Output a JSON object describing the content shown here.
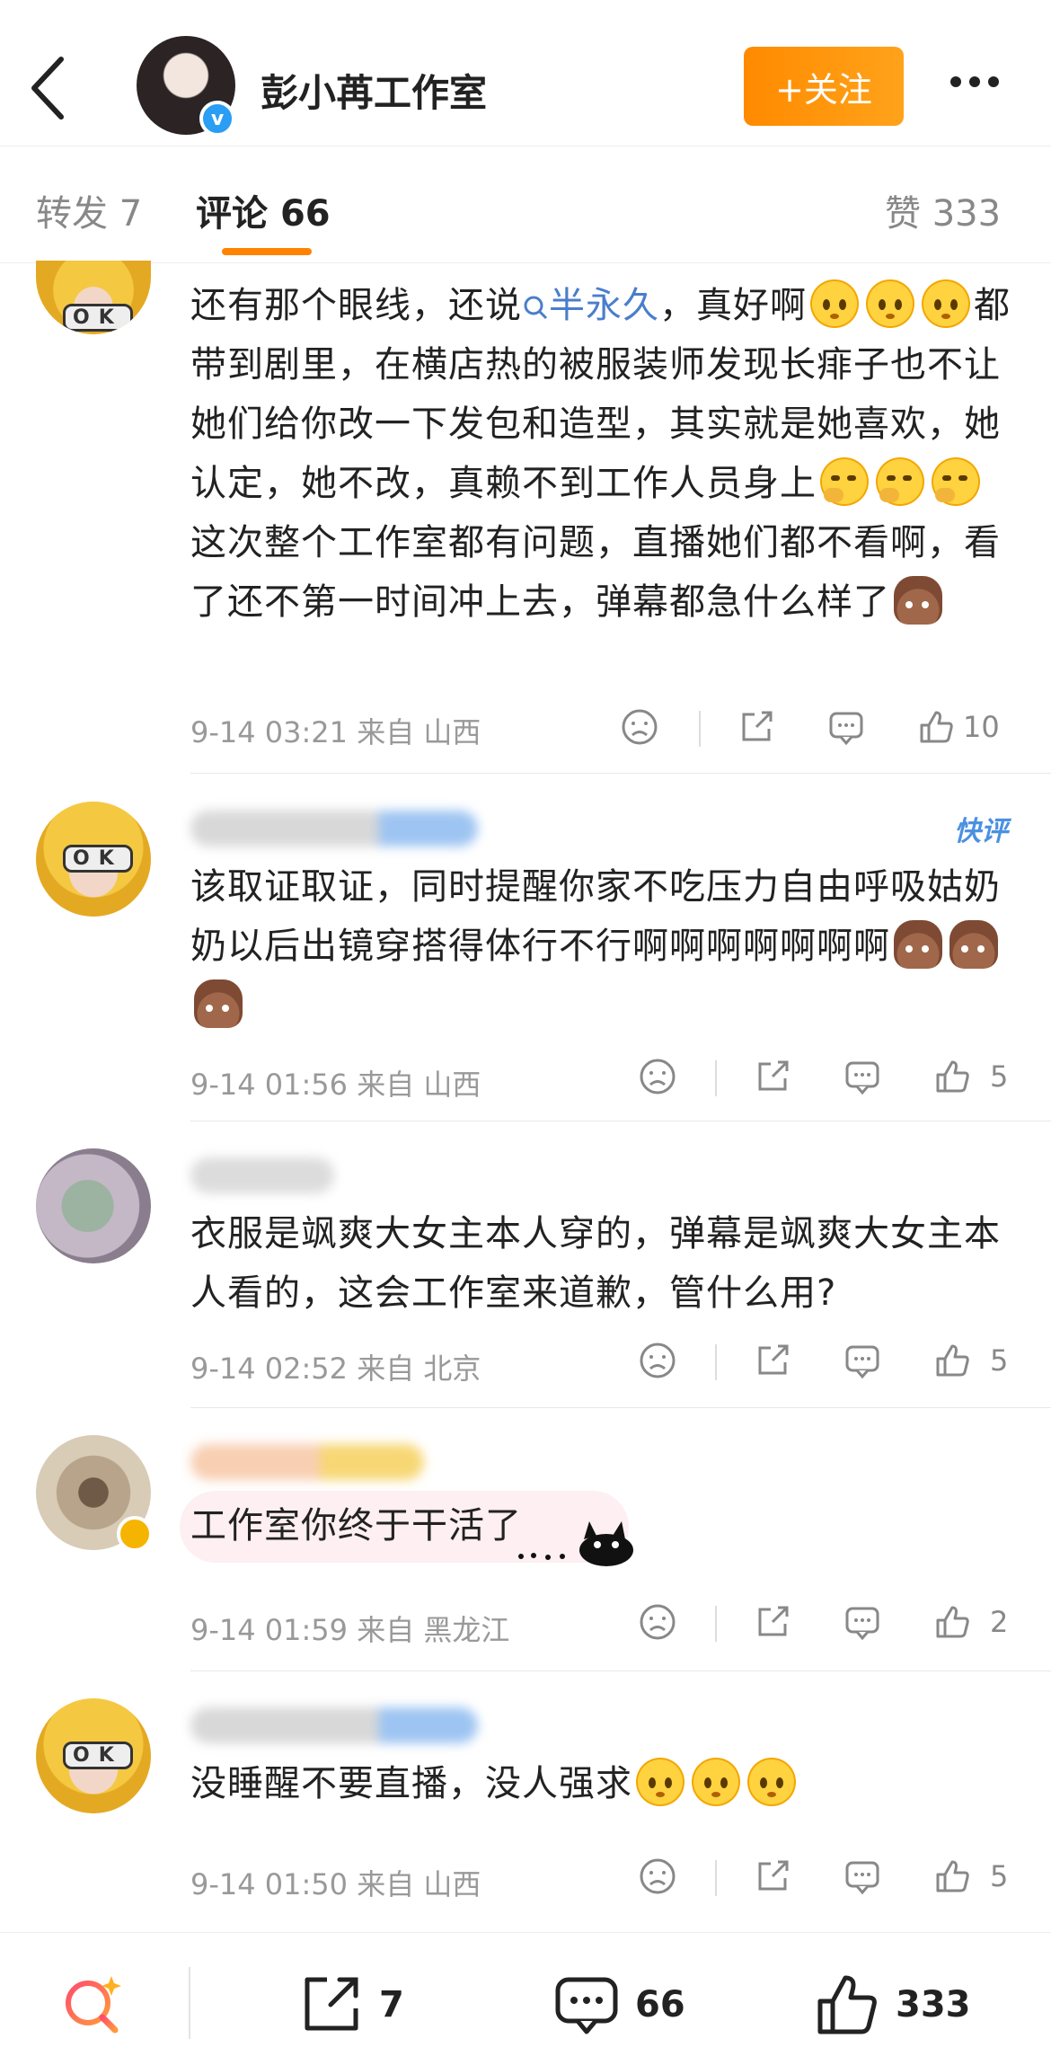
{
  "header": {
    "back_label": "<",
    "studio_name": "彭小苒工作室",
    "verified_mark": "v",
    "follow_label": "+关注",
    "more_label": "•••"
  },
  "tabs": [
    {
      "label": "转发",
      "count": "7"
    },
    {
      "label": "评论",
      "count": "66"
    },
    {
      "label": "赞",
      "count": "333"
    }
  ],
  "comments": [
    {
      "text_parts": [
        "还有那个眼线，还说",
        "半永久",
        "，真好啊",
        "都带到剧里，在横店热的被服装师发现长痱子也不让她们给你改一下发包和造型，其实就是她喜欢，她认定，她不改，真赖不到工作人员身上",
        "这次整个工作室都有问题，直播她们都不看啊，看了还不第一时间冲上去，弹幕都急什么样了"
      ],
      "time": "9-14 03:21",
      "from": "来自",
      "location": "山西",
      "likes": "10"
    },
    {
      "badge": "快评",
      "text_parts": [
        "该取证取证，同时提醒你家不吃压力自由呼吸姑奶奶以后出镜穿搭得体行不行啊啊啊啊啊啊啊"
      ],
      "time": "9-14 01:56",
      "from": "来自",
      "location": "山西",
      "likes": "5"
    },
    {
      "text_parts": [
        "衣服是飒爽大女主本人穿的，弹幕是飒爽大女主本人看的，这会工作室来道歉，管什么用?"
      ],
      "time": "9-14 02:52",
      "from": "来自",
      "location": "北京",
      "likes": "5"
    },
    {
      "text_parts": [
        "工作室你终于干活了"
      ],
      "time": "9-14 01:59",
      "from": "来自",
      "location": "黑龙江",
      "likes": "2"
    },
    {
      "text_parts": [
        "没睡醒不要直播，没人强求"
      ],
      "time": "9-14 01:50",
      "from": "来自",
      "location": "山西",
      "likes": "5"
    }
  ],
  "bottom_bar": {
    "repost_count": "7",
    "comment_count": "66",
    "like_count": "333"
  },
  "colors": {
    "accent_orange": "#ff8200",
    "link_blue": "#4a7ecc",
    "verified_blue": "#2a9df4",
    "verified_gold": "#f5b400"
  }
}
